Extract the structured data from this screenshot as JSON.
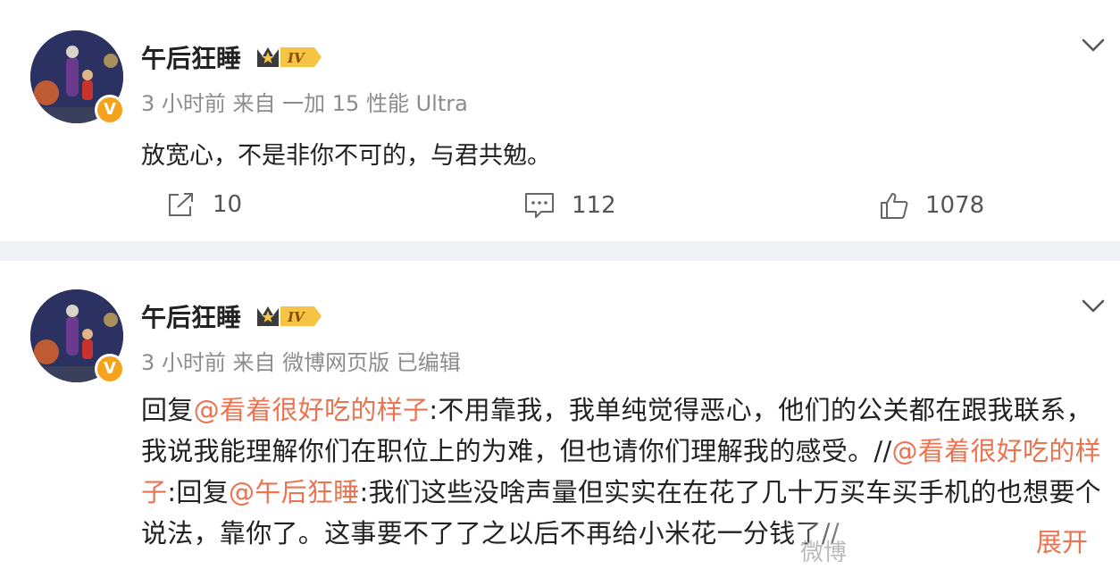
{
  "posts": [
    {
      "author": "午后狂睡",
      "level_badge": "IV",
      "verified_badge": "V",
      "meta": "3 小时前  来自 一加 15 性能 Ultra",
      "text": "放宽心，不是非你不可的，与君共勉。",
      "actions": {
        "repost": "10",
        "comment": "112",
        "like": "1078"
      }
    },
    {
      "author": "午后狂睡",
      "level_badge": "IV",
      "verified_badge": "V",
      "meta": "3 小时前  来自 微博网页版 已编辑",
      "segments": {
        "s1": "回复",
        "m1": "@看着很好吃的样子",
        "s2": ":不用靠我，我单纯觉得恶心，他们的公关都在跟我联系，我说我能理解你们在职位上的为难，但也请你们理解我的感受。//",
        "m2": "@看着很好吃的样子",
        "s3": ":回复",
        "m3": "@午后狂睡",
        "s4": ":我们这些没啥声量但实实在在花了几十万买车买手机的也想要个说法，靠你了。这事要不了了之以后不再给小米花一分钱了//"
      },
      "expand": "展开",
      "watermark": "微博"
    }
  ],
  "colors": {
    "accent": "#eb7350",
    "meta": "#8c8c8c",
    "badge": "#f5a31d",
    "background": "#f1f2f5"
  }
}
